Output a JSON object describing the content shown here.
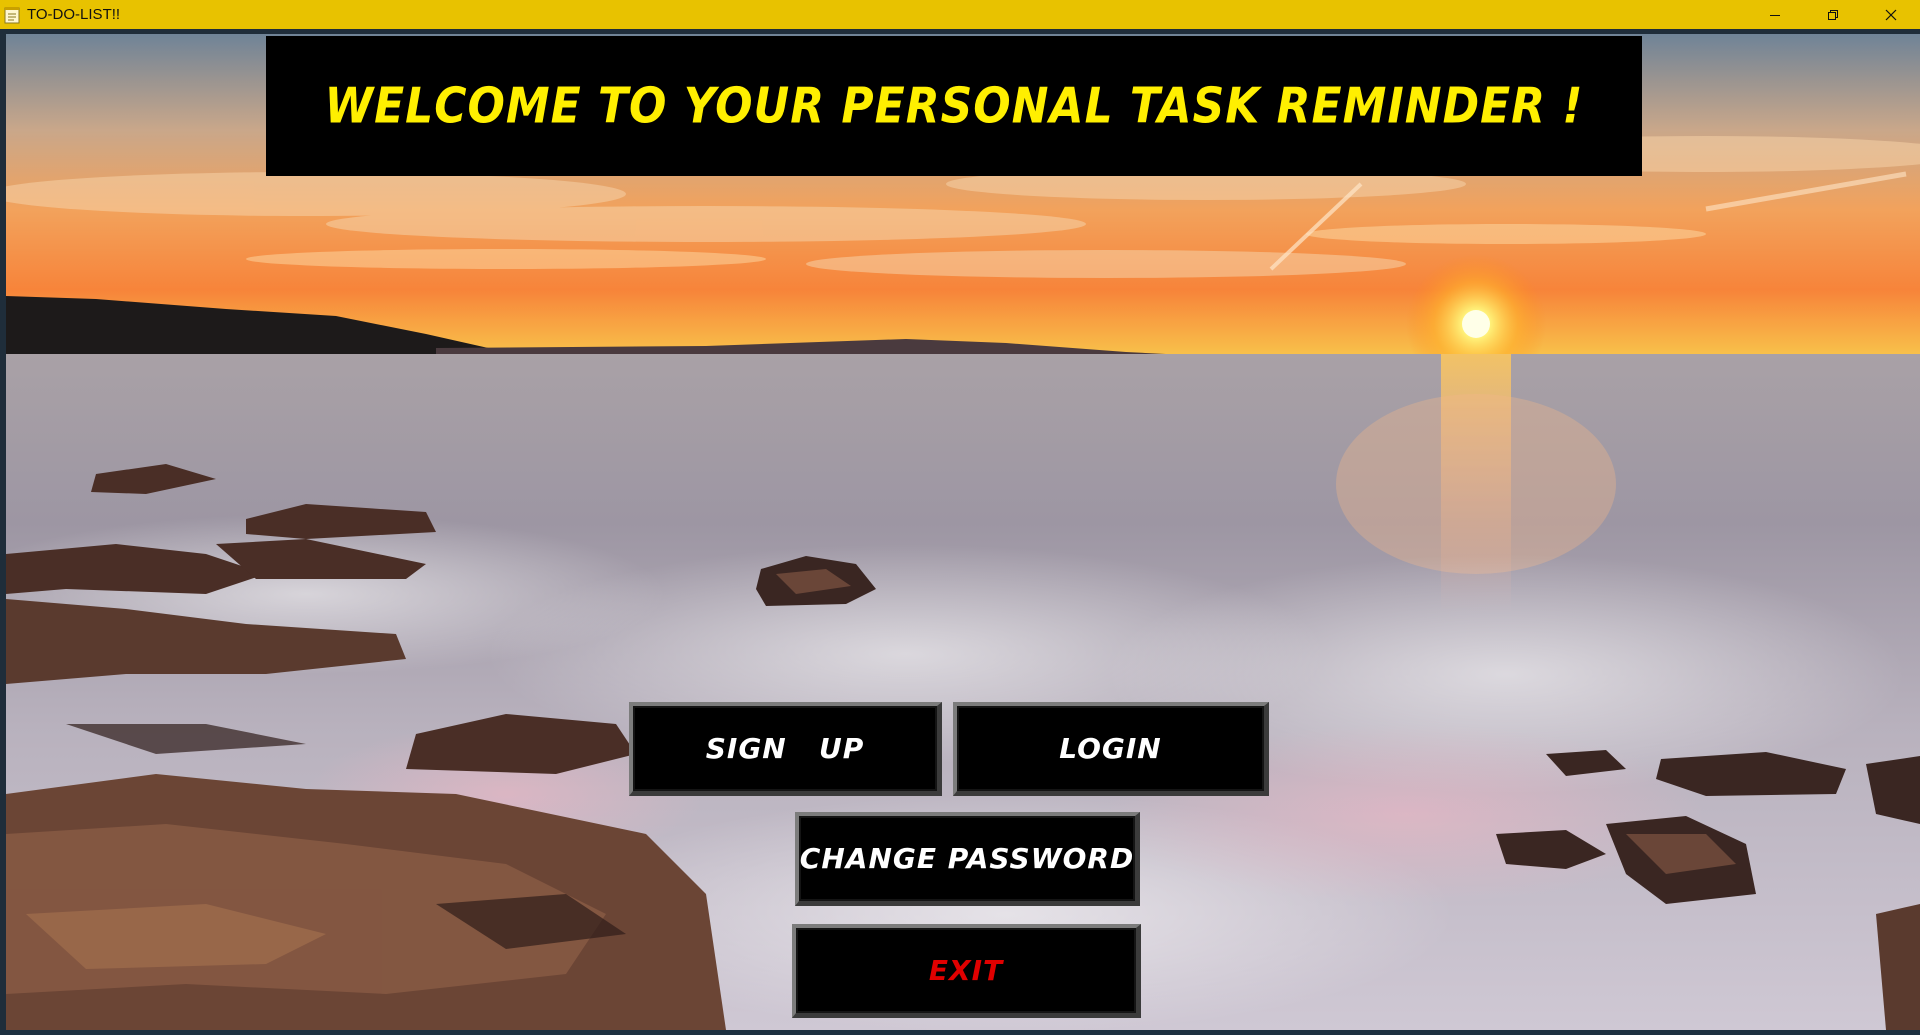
{
  "window": {
    "title": "TO-DO-LIST!!",
    "controls": [
      "minimize-icon",
      "maximize-icon",
      "close-icon"
    ],
    "titlebar_color": "#e8c200"
  },
  "banner": {
    "heading": "WELCOME TO YOUR PERSONAL TASK REMINDER !",
    "text_color": "#ffef00",
    "background": "#000000"
  },
  "buttons": {
    "signup": "SIGN   UP",
    "login": "LOGIN",
    "change_password": "CHANGE PASSWORD",
    "exit": "EXIT"
  },
  "colors": {
    "button_text": "#ffffff",
    "exit_text": "#e00000"
  },
  "background_image": "sunset-seascape"
}
